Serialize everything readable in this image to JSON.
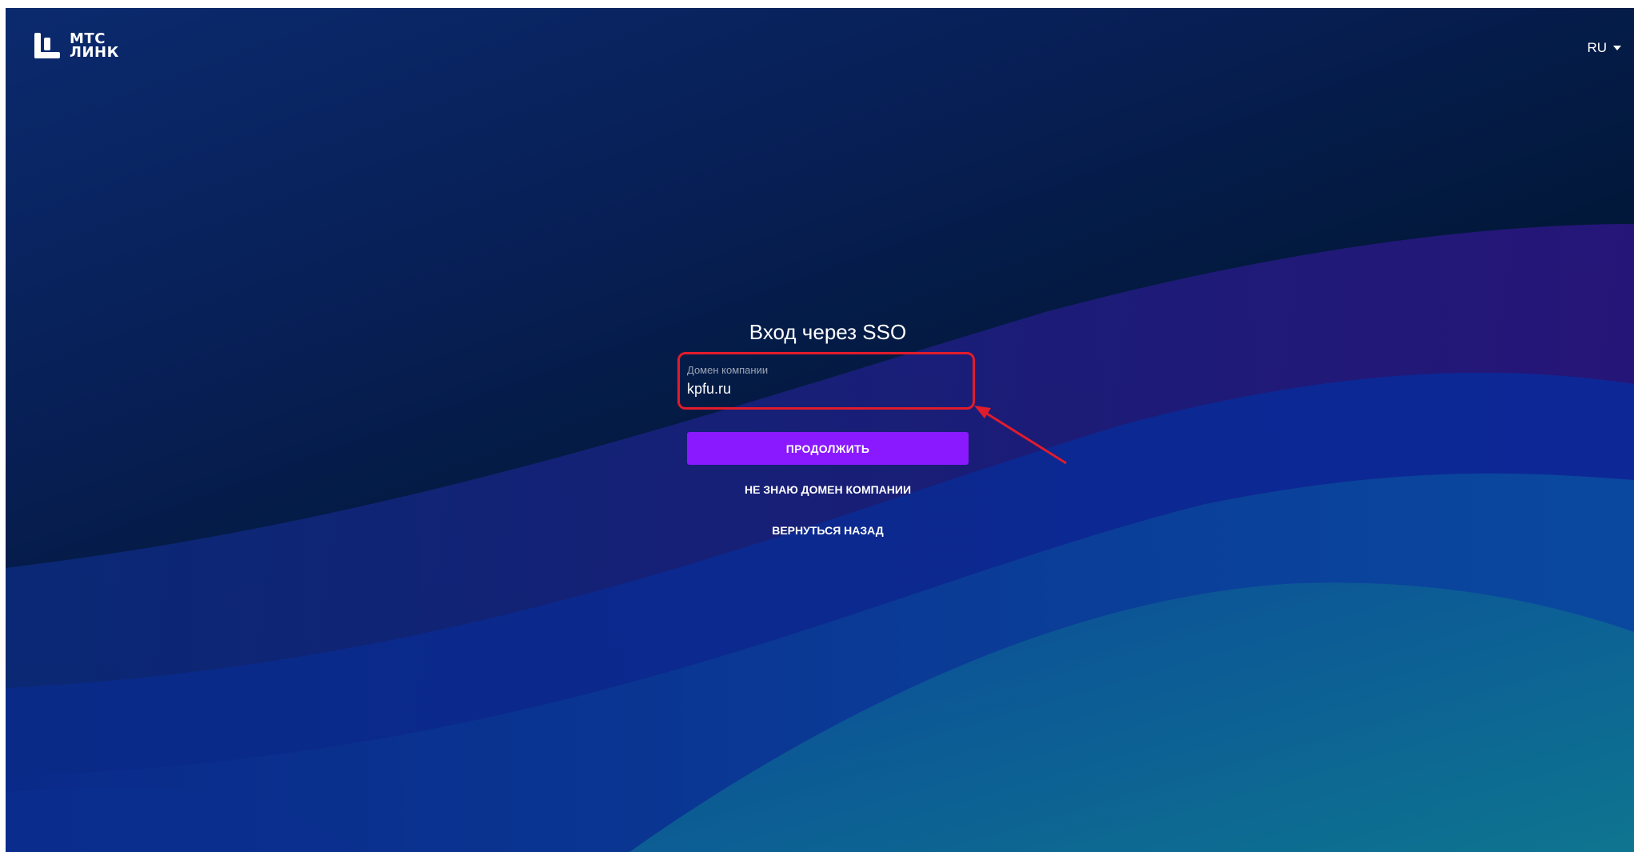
{
  "header": {
    "logo": {
      "line1": "МТС",
      "line2": "ЛИНК"
    },
    "language": "RU"
  },
  "form": {
    "title": "Вход через SSO",
    "domain_label": "Домен компании",
    "domain_value": "kpfu.ru",
    "continue_label": "ПРОДОЛЖИТЬ",
    "unknown_domain_label": "НЕ ЗНАЮ ДОМЕН КОМПАНИИ",
    "back_label": "ВЕРНУТЬСЯ НАЗАД"
  },
  "colors": {
    "button": "#8a19ff",
    "annotation": "#e11c2c"
  }
}
